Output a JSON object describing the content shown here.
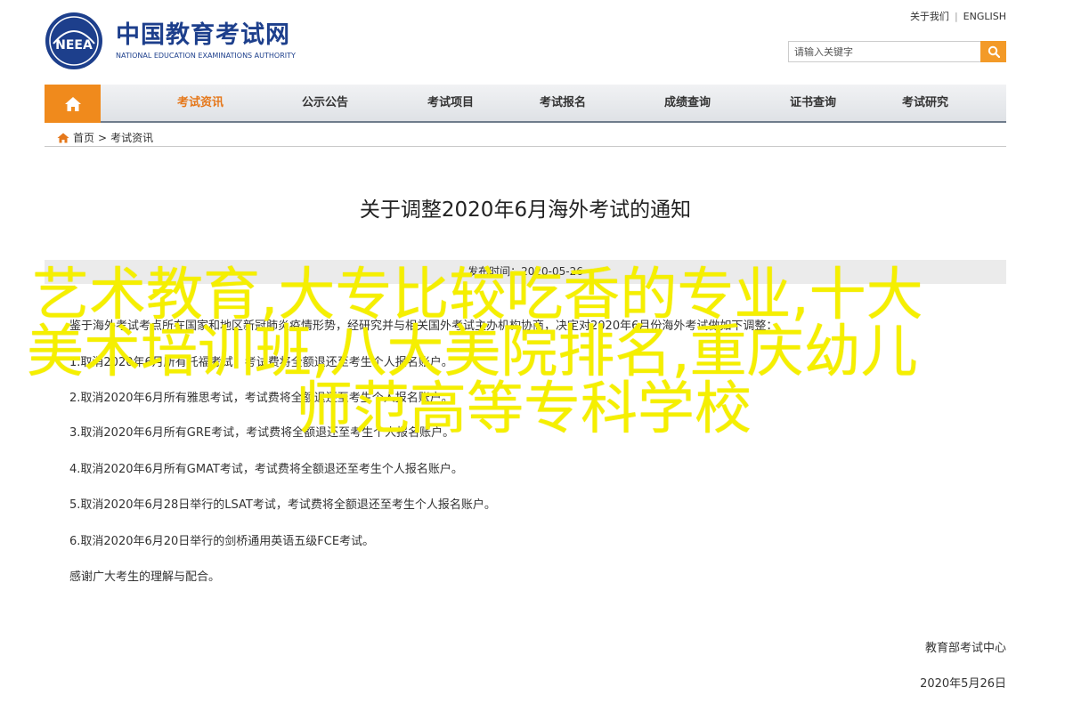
{
  "header": {
    "logo_cn": "中国教育考试网",
    "logo_en": "NATIONAL EDUCATION EXAMINATIONS AUTHORITY",
    "logo_emblem_text": "NEEA",
    "favorite_link": "关于我们",
    "separator": "|",
    "english_link": "ENGLISH",
    "search_placeholder": "请输入关键字"
  },
  "nav": {
    "items": [
      "考试资讯",
      "公示公告",
      "考试项目",
      "考试报名",
      "成绩查询",
      "证书查询",
      "考试研究"
    ],
    "active_index": 0
  },
  "breadcrumb": {
    "home": "首页",
    "separator": ">",
    "current": "考试资讯"
  },
  "article": {
    "title": "关于调整2020年6月海外考试的通知",
    "meta": "发布时间：2020-05-26",
    "paragraphs": [
      "鉴于海外考试考点所在国家和地区新冠肺炎疫情形势，经研究并与相关国外考试主办机构协商，决定对2020年6月份海外考试做如下调整：",
      "1.取消2020年6月所有托福考试，考试费将全额退还至考生个人报名账户。",
      "2.取消2020年6月所有雅思考试，考试费将全额退还至考生个人报名账户。",
      "3.取消2020年6月所有GRE考试，考试费将全额退还至考生个人报名账户。",
      "4.取消2020年6月所有GMAT考试，考试费将全额退还至考生个人报名账户。",
      "5.取消2020年6月28日举行的LSAT考试，考试费将全额退还至考生个人报名账户。",
      "6.取消2020年6月20日举行的剑桥通用英语五级FCE考试。",
      "感谢广大考生的理解与配合。"
    ],
    "signature_org": "教育部考试中心",
    "signature_date": "2020年5月26日"
  },
  "overlay": {
    "line1": "艺术教育,大专比较吃香的专业,十大",
    "line2": "美术培训班,八大美院排名,重庆幼儿",
    "line3": "师范高等专科学校",
    "color": "#f5ef00"
  },
  "colors": {
    "brand_blue": "#1d3f8c",
    "accent_orange": "#f08a1c",
    "active_nav": "#e5781b"
  }
}
